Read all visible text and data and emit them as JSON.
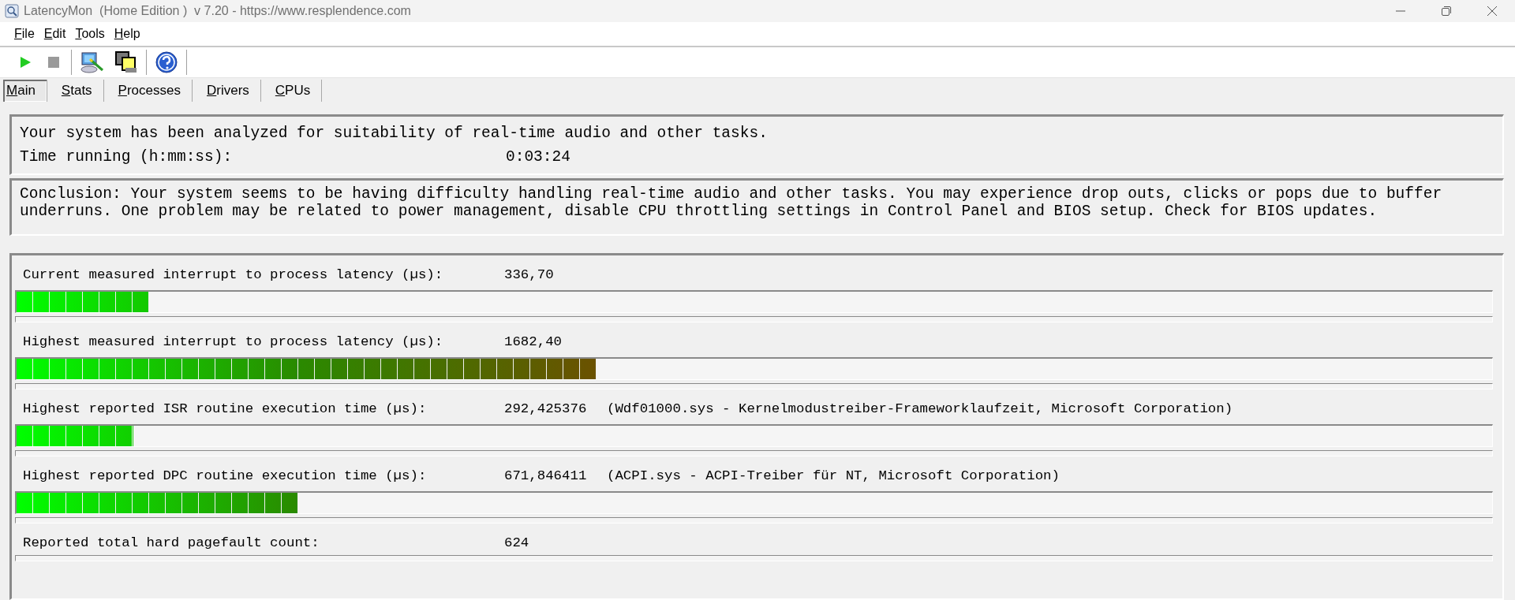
{
  "window": {
    "title": "LatencyMon  (Home Edition )  v 7.20 - https://www.resplendence.com"
  },
  "menu": [
    "File",
    "Edit",
    "Tools",
    "Help"
  ],
  "tabs": [
    {
      "label": "Main",
      "selected": true
    },
    {
      "label": "Stats",
      "selected": false
    },
    {
      "label": "Processes",
      "selected": false
    },
    {
      "label": "Drivers",
      "selected": false
    },
    {
      "label": "CPUs",
      "selected": false
    }
  ],
  "summary": {
    "message": "Your system has been analyzed for suitability of real-time audio and other tasks.",
    "time_label": "Time running (h:mm:ss):",
    "time_value": "0:03:24"
  },
  "conclusion": "Conclusion: Your system seems to be having difficulty handling real-time audio and other tasks. You may experience drop outs, clicks or pops due to buffer underruns. One problem may be related to power management, disable CPU throttling settings in Control Panel and BIOS setup. Check for BIOS updates.",
  "metrics": [
    {
      "kind": "meter",
      "label": "Current measured interrupt to process latency (µs):",
      "value": "336,70",
      "level": 0.09
    },
    {
      "kind": "meter",
      "label": "Highest measured interrupt to process latency (µs):",
      "value": "1682,40",
      "level": 0.393
    },
    {
      "kind": "meter",
      "label": "Highest reported ISR routine execution time (µs):",
      "value": "292,425376",
      "detail": "(Wdf01000.sys - Kernelmodustreiber-Frameworklaufzeit, Microsoft Corporation)",
      "level": 0.079
    },
    {
      "kind": "meter",
      "label": "Highest reported DPC routine execution time (µs):",
      "value": "671,846411",
      "detail": "(ACPI.sys - ACPI-Treiber für NT, Microsoft Corporation)",
      "level": 0.191
    },
    {
      "kind": "count",
      "label": "Reported total hard pagefault count:",
      "value": "624"
    }
  ]
}
